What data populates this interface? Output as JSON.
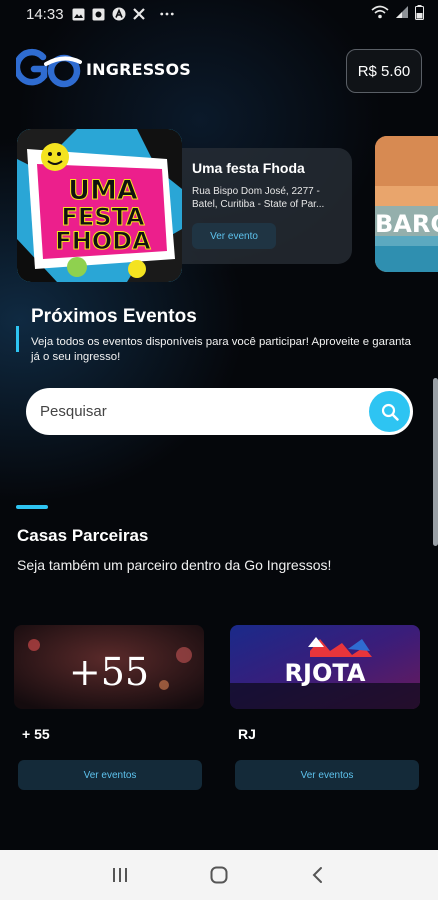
{
  "status_bar": {
    "time": "14:33",
    "left_icons": [
      "image-icon",
      "photo-icon",
      "a-icon",
      "tools-icon",
      "more-dots-icon"
    ],
    "right_icons": [
      "wifi-icon",
      "signal-icon",
      "battery-icon"
    ]
  },
  "header": {
    "logo_mark": "Go",
    "logo_text": "INGRESSOS",
    "balance": "R$ 5.60"
  },
  "featured": {
    "poster_text": [
      "UMA",
      "FESTA",
      "FHODA"
    ],
    "title": "Uma festa Fhoda",
    "address": "Rua Bispo Dom José, 2277 - Batel, Curitiba - State of Par...",
    "button": "Ver evento",
    "next_poster_text": "BARC"
  },
  "upcoming": {
    "title": "Próximos Eventos",
    "description": "Veja todos os eventos disponíveis para você participar! Aproveite e garanta já o seu ingresso!"
  },
  "search": {
    "placeholder": "Pesquisar"
  },
  "partners": {
    "title": "Casas Parceiras",
    "subtitle": "Seja também um parceiro dentro da Go Ingressos!",
    "items": [
      {
        "logo": "+55",
        "name": "+ 55",
        "button": "Ver eventos"
      },
      {
        "logo": "RJOTA",
        "name": "RJ",
        "button": "Ver eventos"
      }
    ]
  },
  "colors": {
    "accent": "#2ec4f2",
    "brand_blue": "#2f6cd1",
    "background": "#05070b"
  }
}
